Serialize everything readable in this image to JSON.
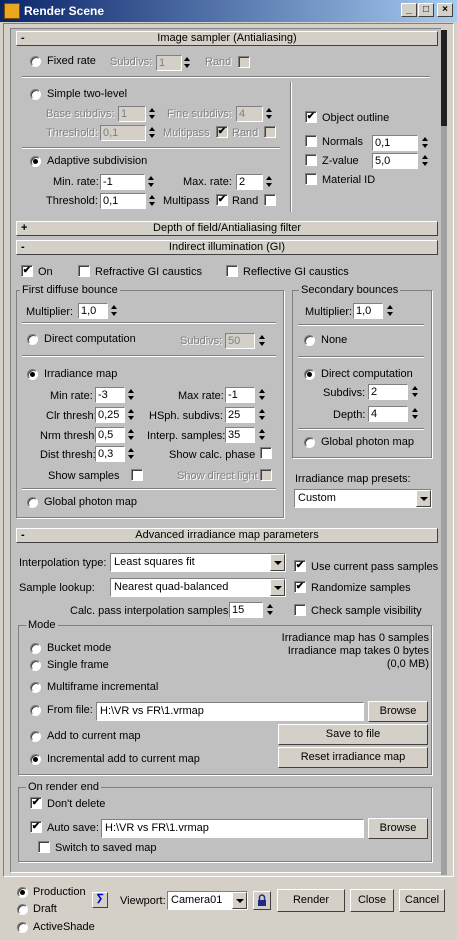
{
  "window": {
    "title": "Render Scene",
    "btn_min": "_",
    "btn_max": "□",
    "btn_close": "×"
  },
  "rollouts": {
    "image_sampler": "Image sampler (Antialiasing)",
    "dof": "Depth of field/Antialiasing filter",
    "gi": "Indirect illumination (GI)",
    "adv": "Advanced irradiance map parameters",
    "minus": "-",
    "plus": "+"
  },
  "sampler": {
    "fixed_rate": "Fixed rate",
    "subdivs": "Subdivs:",
    "subdivs_val": "1",
    "rand": "Rand",
    "simple": "Simple two-level",
    "base_subdivs": "Base subdivs:",
    "base_val": "1",
    "fine_subdivs": "Fine subdivs:",
    "fine_val": "4",
    "threshold": "Threshold:",
    "thr_val": "0,1",
    "multipass": "Multipass",
    "rand2": "Rand",
    "adaptive": "Adaptive subdivision",
    "min_rate": "Min. rate:",
    "min_val": "-1",
    "max_rate": "Max. rate:",
    "max_val": "2",
    "threshold2": "Threshold:",
    "thr2_val": "0,1",
    "multipass2": "Multipass",
    "rand3": "Rand",
    "object_outline": "Object outline",
    "normals": "Normals",
    "normals_val": "0,1",
    "zvalue": "Z-value",
    "zvalue_val": "5,0",
    "material_id": "Material ID"
  },
  "gi": {
    "on": "On",
    "refr": "Refractive GI caustics",
    "refl": "Reflective GI caustics",
    "first": "First diffuse bounce",
    "multiplier": "Multiplier:",
    "mult1": "1,0",
    "direct": "Direct computation",
    "subdivs": "Subdivs:",
    "subdivs_val": "50",
    "irr": "Irradiance map",
    "min_rate": "Min rate:",
    "min_val": "-3",
    "max_rate": "Max rate:",
    "max_val": "-1",
    "clr": "Clr thresh:",
    "clr_val": "0,25",
    "hsph": "HSph. subdivs:",
    "hsph_val": "25",
    "nrm": "Nrm thresh:",
    "nrm_val": "0,5",
    "interp": "Interp. samples:",
    "interp_val": "35",
    "dist": "Dist thresh:",
    "dist_val": "0,3",
    "show_calc": "Show calc. phase",
    "show_samples": "Show samples",
    "show_direct": "Show direct light",
    "global": "Global photon map",
    "second": "Secondary bounces",
    "mult2": "1,0",
    "none": "None",
    "direct2": "Direct computation",
    "subdivs2": "Subdivs:",
    "subdivs2_val": "2",
    "depth": "Depth:",
    "depth_val": "4",
    "global2": "Global photon map",
    "presets": "Irradiance map presets:",
    "preset_val": "Custom"
  },
  "adv": {
    "interp_type": "Interpolation type:",
    "interp_val": "Least squares fit",
    "lookup": "Sample lookup:",
    "lookup_val": "Nearest quad-balanced",
    "calc": "Calc. pass interpolation samples:",
    "calc_val": "15",
    "use_current": "Use current pass samples",
    "randomize": "Randomize samples",
    "check_vis": "Check sample visibility",
    "mode": "Mode",
    "bucket": "Bucket mode",
    "single": "Single frame",
    "multi": "Multiframe incremental",
    "from_file": "From file:",
    "file_val": "H:\\VR vs FR\\1.vrmap",
    "browse": "Browse",
    "add_current": "Add to current map",
    "incremental": "Incremental add to current map",
    "save": "Save to file",
    "reset": "Reset irradiance map",
    "info1": "Irradiance map has 0 samples",
    "info2": "Irradiance map takes 0 bytes",
    "info3": "(0,0 MB)",
    "on_end": "On render end",
    "dont_delete": "Don't delete",
    "auto_save": "Auto save:",
    "auto_val": "H:\\VR vs FR\\1.vrmap",
    "browse2": "Browse",
    "switch": "Switch to saved map"
  },
  "bottom": {
    "production": "Production",
    "draft": "Draft",
    "activeshade": "ActiveShade",
    "viewport": "Viewport:",
    "viewport_val": "Camera01",
    "render": "Render",
    "close": "Close",
    "cancel": "Cancel"
  }
}
